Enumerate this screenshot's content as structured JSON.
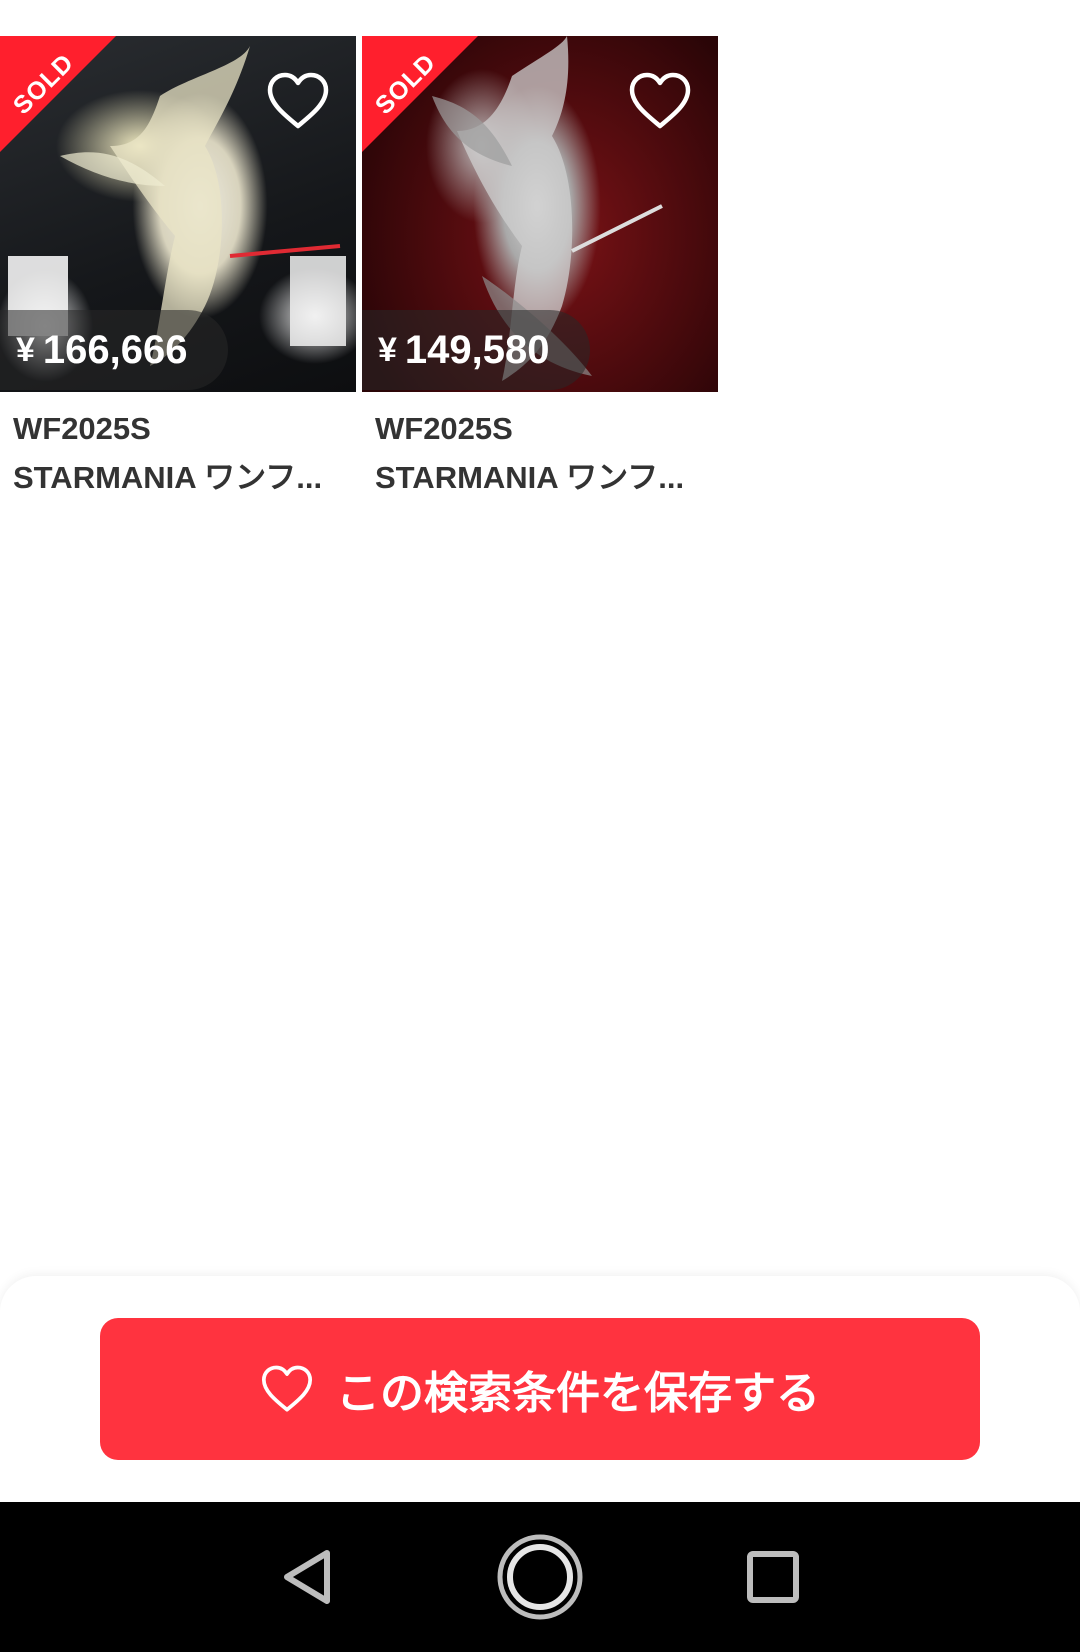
{
  "products": [
    {
      "sold_label": "SOLD",
      "currency": "¥",
      "price": "166,666",
      "title_line1": "WF2025S",
      "title_line2": "STARMANIA ワンフ..."
    },
    {
      "sold_label": "SOLD",
      "currency": "¥",
      "price": "149,580",
      "title_line1": "WF2025S",
      "title_line2": "STARMANIA ワンフ..."
    }
  ],
  "save_search": {
    "label": "この検索条件を保存する",
    "icon": "heart-outline-icon"
  },
  "nav": {
    "back_icon": "triangle-back-icon",
    "home_icon": "circle-home-icon",
    "recents_icon": "square-recents-icon"
  },
  "colors": {
    "accent": "#ff333f",
    "sold_ribbon": "#ff1f2d",
    "text_dark": "#333333",
    "nav_bar": "#000000"
  }
}
